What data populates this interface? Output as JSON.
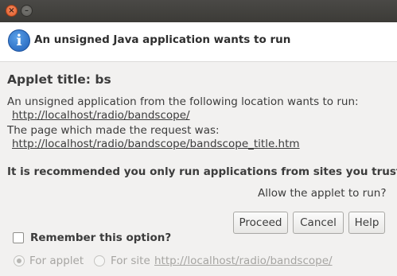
{
  "window": {
    "close_symbol": "×",
    "minimize_symbol": "–"
  },
  "header": {
    "icon_glyph": "i",
    "title": "An unsigned Java application wants to run"
  },
  "body": {
    "applet_title": "Applet title: bs",
    "location_intro": "An unsigned application from the following location wants to run:",
    "location_url": "http://localhost/radio/bandscope/",
    "page_intro": "The page which made the request was:",
    "page_url": "http://localhost/radio/bandscope/bandscope_title.htm",
    "recommendation": "It is recommended you only run applications from sites you trust.",
    "question": "Allow the applet to run?"
  },
  "buttons": {
    "proceed": "Proceed",
    "cancel": "Cancel",
    "help": "Help"
  },
  "remember": {
    "label": "Remember this option?",
    "checked": false
  },
  "scope": {
    "for_applet_label": "For applet",
    "for_site_label": "For site",
    "site_url": "http://localhost/radio/bandscope/",
    "selected": "for_applet"
  },
  "colors": {
    "titlebar": "#3c3b37",
    "info_icon": "#2a6fcd",
    "close_button": "#e9652f"
  }
}
